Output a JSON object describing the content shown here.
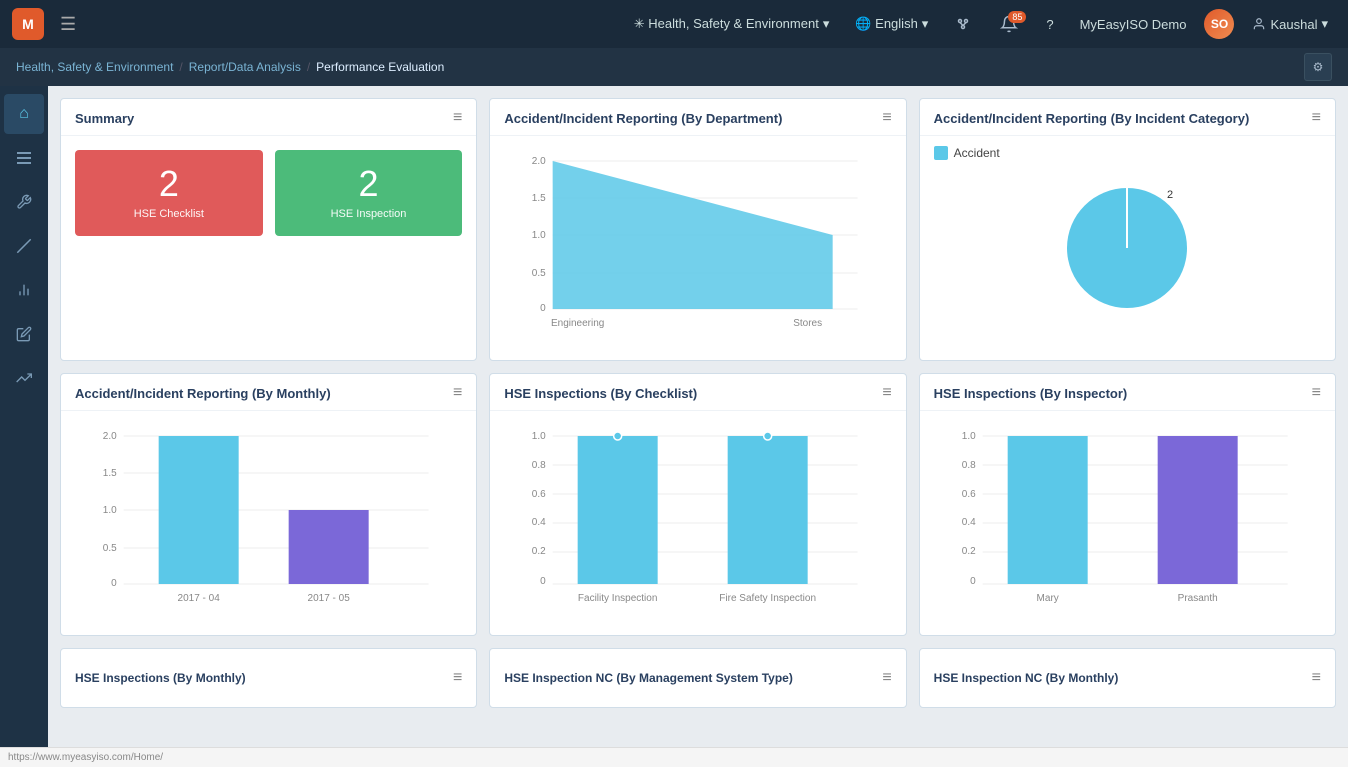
{
  "topnav": {
    "logo_text": "M",
    "menu_icon": "☰",
    "module_label": "✳ Health, Safety & Environment",
    "module_arrow": "▾",
    "language_label": "🌐 English",
    "language_arrow": "▾",
    "connect_icon": "⚙",
    "bell_count": "85",
    "help_icon": "?",
    "company_label": "MyEasyISO Demo",
    "user_label": "Kaushal",
    "user_arrow": "▾"
  },
  "breadcrumb": {
    "part1": "Health, Safety & Environment",
    "sep1": "/",
    "part2": "Report/Data Analysis",
    "sep2": "/",
    "current": "Performance Evaluation"
  },
  "sidebar": {
    "items": [
      {
        "icon": "⌂",
        "name": "home"
      },
      {
        "icon": "☰",
        "name": "list"
      },
      {
        "icon": "🔧",
        "name": "tools"
      },
      {
        "icon": "🌿",
        "name": "leaf"
      },
      {
        "icon": "📊",
        "name": "chart"
      },
      {
        "icon": "✏",
        "name": "edit"
      },
      {
        "icon": "📈",
        "name": "trend"
      }
    ]
  },
  "cards": {
    "summary": {
      "title": "Summary",
      "menu": "≡",
      "tile1_number": "2",
      "tile1_label": "HSE Checklist",
      "tile2_number": "2",
      "tile2_label": "HSE Inspection"
    },
    "dept_chart": {
      "title": "Accident/Incident Reporting (By Department)",
      "menu": "≡",
      "y_labels": [
        "2.0",
        "1.5",
        "1.0",
        "0.5",
        "0"
      ],
      "x_labels": [
        "Engineering",
        "Stores"
      ],
      "data": [
        2.0,
        1.0
      ]
    },
    "incident_cat": {
      "title": "Accident/Incident Reporting (By Incident Category)",
      "menu": "≡",
      "legend_color": "#5bc8e8",
      "legend_label": "Accident",
      "legend_value": "2"
    },
    "monthly_chart": {
      "title": "Accident/Incident Reporting (By Monthly)",
      "menu": "≡",
      "y_labels": [
        "2.0",
        "1.5",
        "1.0",
        "0.5",
        "0"
      ],
      "x_labels": [
        "2017 - 04",
        "2017 - 05"
      ],
      "data": [
        2.0,
        1.0
      ],
      "colors": [
        "#5bc8e8",
        "#7b68d8"
      ]
    },
    "checklist_chart": {
      "title": "HSE Inspections (By Checklist)",
      "menu": "≡",
      "y_labels": [
        "1.0",
        "0.8",
        "0.6",
        "0.4",
        "0.2",
        "0"
      ],
      "x_labels": [
        "Facility Inspection",
        "Fire Safety Inspection"
      ],
      "data": [
        1.0,
        1.0
      ]
    },
    "inspector_chart": {
      "title": "HSE Inspections (By Inspector)",
      "menu": "≡",
      "y_labels": [
        "1.0",
        "0.8",
        "0.6",
        "0.4",
        "0.2",
        "0"
      ],
      "x_labels": [
        "Mary",
        "Prasanth"
      ],
      "data": [
        1.0,
        1.0
      ],
      "colors": [
        "#5bc8e8",
        "#7b68d8"
      ]
    },
    "hse_monthly": {
      "title": "HSE Inspections (By Monthly)",
      "menu": "≡"
    },
    "nc_mgmt": {
      "title": "HSE Inspection NC (By Management System Type)",
      "menu": "≡"
    },
    "nc_monthly": {
      "title": "HSE Inspection NC (By Monthly)",
      "menu": "≡"
    }
  },
  "status_bar": {
    "url": "https://www.myeasyiso.com/Home/"
  }
}
